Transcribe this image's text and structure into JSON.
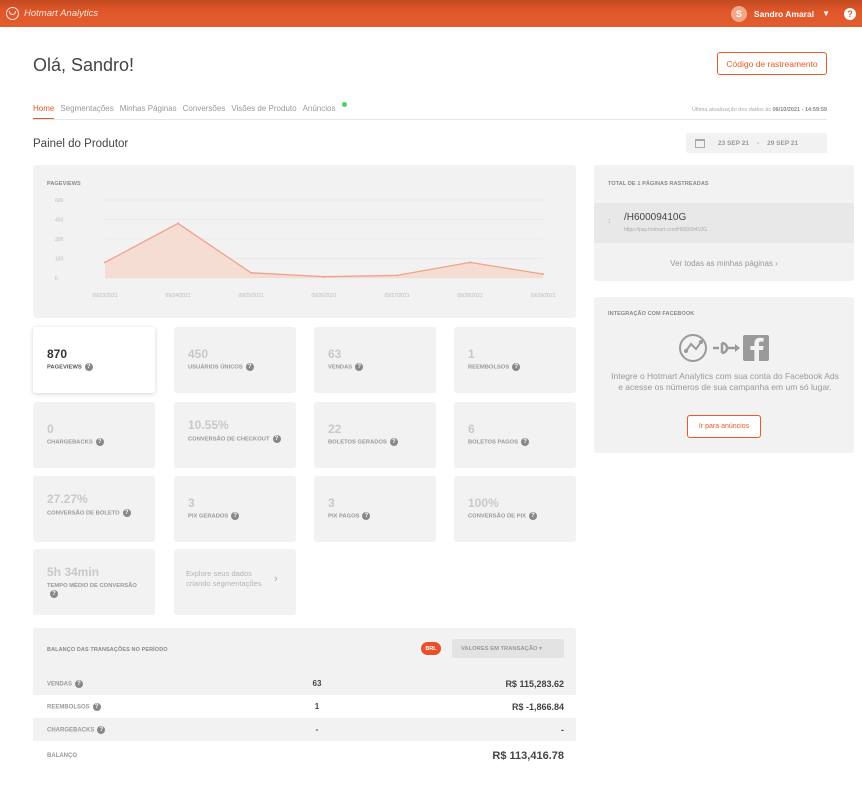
{
  "topbar": {
    "brand": "Hotmart Analytics",
    "user_initial": "S",
    "user_name": "Sandro Amaral",
    "help": "?"
  },
  "greeting": "Olá, Sandro!",
  "tracking_button": "Código de rastreamento",
  "tabs": [
    {
      "label": "Home",
      "active": true
    },
    {
      "label": "Segmentações"
    },
    {
      "label": "Minhas Páginas"
    },
    {
      "label": "Conversões"
    },
    {
      "label": "Visões de Produto"
    },
    {
      "label": "Anúncios",
      "new_dot": true
    }
  ],
  "last_update": {
    "text": "Última atualização dos dados às",
    "value": "06/10/2021 - 14:59:59"
  },
  "page_title": "Painel do Produtor",
  "date_range": {
    "start": "23 SEP 21",
    "sep": "-",
    "end": "29 SEP 21"
  },
  "chart_data": {
    "type": "area",
    "title": "PAGEVIEWS",
    "x": [
      "09/23/2021",
      "09/24/2021",
      "09/25/2021",
      "09/26/2021",
      "09/27/2021",
      "09/28/2021",
      "09/29/2021"
    ],
    "y_ticks": [
      "600",
      "450",
      "300",
      "150",
      "0"
    ],
    "ylim": [
      0,
      600
    ],
    "values": [
      120,
      420,
      40,
      10,
      20,
      120,
      30
    ],
    "color": "#f0a38a",
    "grid": true
  },
  "cards": [
    {
      "value": "870",
      "label": "PAGEVIEWS"
    },
    {
      "value": "450",
      "label": "USUÁRIOS ÚNICOS"
    },
    {
      "value": "63",
      "label": "VENDAS"
    },
    {
      "value": "1",
      "label": "REEMBOLSOS"
    },
    {
      "value": "0",
      "label": "CHARGEBACKS"
    },
    {
      "value": "10.55%",
      "label": "CONVERSÃO DE CHECKOUT"
    },
    {
      "value": "22",
      "label": "BOLETOS GERADOS"
    },
    {
      "value": "6",
      "label": "BOLETOS PAGOS"
    },
    {
      "value": "27.27%",
      "label": "CONVERSÃO DE BOLETO"
    },
    {
      "value": "3",
      "label": "PIX GERADOS"
    },
    {
      "value": "3",
      "label": "PIX PAGOS"
    },
    {
      "value": "100%",
      "label": "CONVERSÃO DE PIX"
    },
    {
      "value": "5h 34min",
      "label": "TEMPO MÉDIO DE CONVERSÃO"
    }
  ],
  "explore": {
    "line1": "Explore seus dados",
    "line2": "criando segmentações"
  },
  "balance": {
    "title": "BALANÇO DAS TRANSAÇÕES NO PERÍODO",
    "currency": "BRL",
    "select": "VALORES EM TRANSAÇÃO ▾",
    "rows": [
      {
        "label": "VENDAS",
        "count": "63",
        "amount": "R$ 115,283.62"
      },
      {
        "label": "REEMBOLSOS",
        "count": "1",
        "amount": "R$ -1,866.84"
      },
      {
        "label": "CHARGEBACKS",
        "count": "-",
        "amount": "-"
      }
    ],
    "total_label": "BALANÇO",
    "total_amount": "R$ 113,416.78"
  },
  "pages": {
    "title": "TOTAL DE 1 PÁGINAS RASTREADAS",
    "items": [
      {
        "num": "1",
        "name": "/H60009410G",
        "url": "https://pay.hotmart.com/H60009410G"
      }
    ],
    "see_all": "Ver todas as minhas páginas"
  },
  "facebook": {
    "title": "INTEGRAÇÃO COM FACEBOOK",
    "text": "Integre o Hotmart Analytics com sua conta do Facebook Ads e acesse os números de sua campanha em um só lugar.",
    "button": "Ir para anúncios"
  }
}
